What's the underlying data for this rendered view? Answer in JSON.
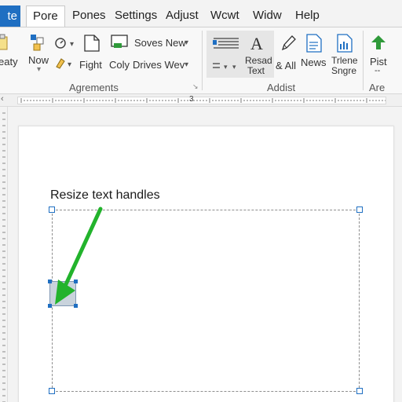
{
  "menu": {
    "file_label": "te",
    "tabs": [
      "Pore",
      "Pones",
      "Settings",
      "Adjust",
      "Wcwt",
      "Widw",
      "Help"
    ]
  },
  "ribbon": {
    "group1": {
      "paste_label": "eaty",
      "now_label": "Now",
      "fight_label": "Fight",
      "coly_label": "Coly",
      "drives_label": "Drives Wev",
      "soves_label": "Soves New",
      "group_label": "Agrements"
    },
    "group2": {
      "resad_label_1": "Resad",
      "resad_label_2": "Text",
      "all_label": "& All",
      "news_label": "News",
      "trlene_label_1": "Trlene",
      "trlene_label_2": "Sngre",
      "group_label": "Addist"
    },
    "group3": {
      "pist_label": "Pist",
      "dash_label": "--",
      "group_label": "Are"
    }
  },
  "ruler": {
    "marker": "3"
  },
  "document": {
    "caption": "Resize text handles"
  },
  "colors": {
    "accent": "#1f6fc2",
    "arrow": "#22b32c"
  }
}
